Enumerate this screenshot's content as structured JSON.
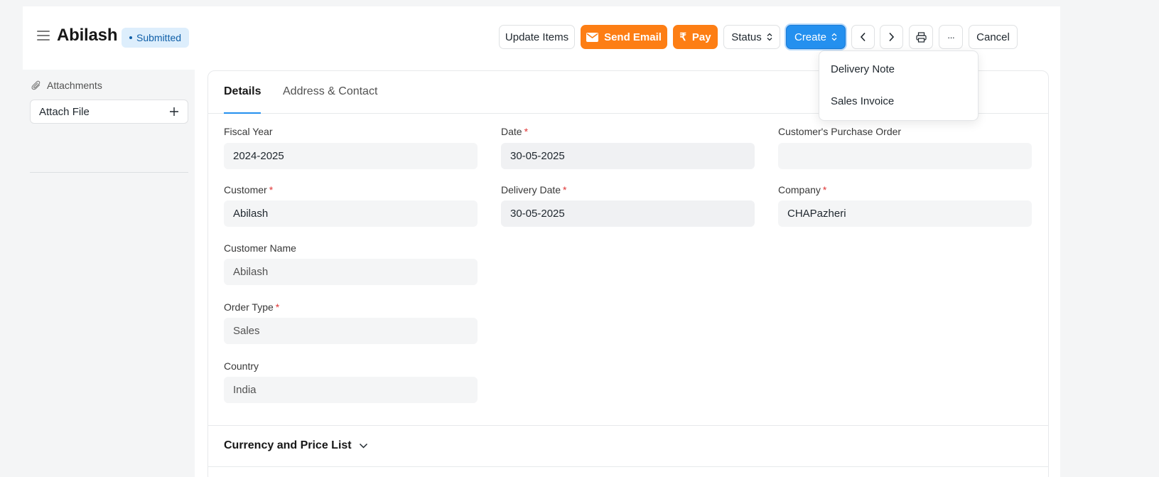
{
  "header": {
    "title": "Abilash",
    "status": "Submitted",
    "buttons": {
      "update_items": "Update Items",
      "send_email": "Send Email",
      "pay": "Pay",
      "status": "Status",
      "create": "Create",
      "more": "···",
      "cancel": "Cancel"
    },
    "pay_symbol": "₹"
  },
  "create_menu": {
    "items": [
      "Delivery Note",
      "Sales Invoice"
    ]
  },
  "sidebar": {
    "attachments_label": "Attachments",
    "attach_file_label": "Attach File"
  },
  "tabs": [
    "Details",
    "Address & Contact"
  ],
  "fields": {
    "fiscal_year": {
      "label": "Fiscal Year",
      "value": "2024-2025"
    },
    "date": {
      "label": "Date",
      "value": "30-05-2025",
      "required_mark": "*"
    },
    "customer_po": {
      "label": "Customer's Purchase Order",
      "value": ""
    },
    "customer": {
      "label": "Customer",
      "value": "Abilash",
      "required_mark": "*"
    },
    "delivery_date": {
      "label": "Delivery Date",
      "value": "30-05-2025",
      "required_mark": "*"
    },
    "company": {
      "label": "Company",
      "value": "CHAPazheri",
      "required_mark": "*"
    },
    "customer_name": {
      "label": "Customer Name",
      "value": "Abilash"
    },
    "order_type": {
      "label": "Order Type",
      "value": "Sales",
      "required_mark": "*"
    },
    "country": {
      "label": "Country",
      "value": "India"
    }
  },
  "sections": {
    "currency_price_list": "Currency and Price List"
  },
  "colors": {
    "accent_blue": "#2490ef",
    "orange": "#fd7e14",
    "badge_bg": "#ddeefc",
    "badge_text": "#0f5fa8",
    "required": "#e03636"
  }
}
